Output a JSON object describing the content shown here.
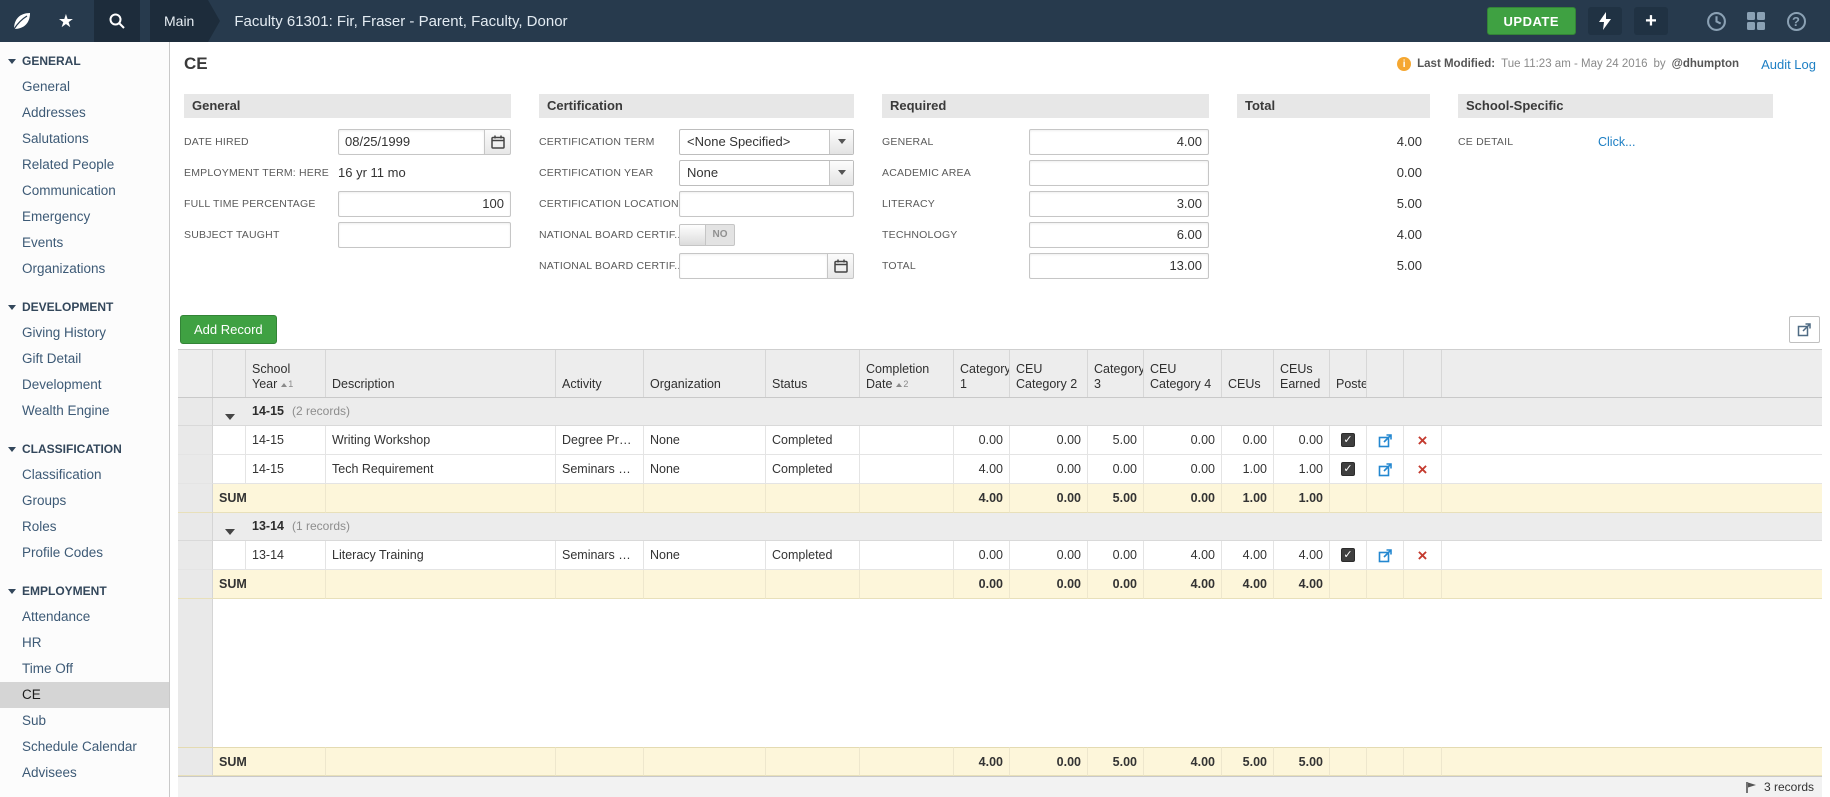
{
  "topbar": {
    "breadcrumb": "Main",
    "title": "Faculty 61301: Fir, Fraser - Parent, Faculty, Donor",
    "update": "UPDATE"
  },
  "sidebar": {
    "sections": [
      {
        "label": "GENERAL",
        "items": [
          "General",
          "Addresses",
          "Salutations",
          "Related People",
          "Communication",
          "Emergency",
          "Events",
          "Organizations"
        ]
      },
      {
        "label": "DEVELOPMENT",
        "items": [
          "Giving History",
          "Gift Detail",
          "Development",
          "Wealth Engine"
        ]
      },
      {
        "label": "CLASSIFICATION",
        "items": [
          "Classification",
          "Groups",
          "Roles",
          "Profile Codes"
        ]
      },
      {
        "label": "EMPLOYMENT",
        "items": [
          "Attendance",
          "HR",
          "Time Off",
          "CE",
          "Sub",
          "Schedule Calendar",
          "Advisees"
        ]
      }
    ]
  },
  "page": {
    "title": "CE",
    "last_modified_label": "Last Modified:",
    "last_modified_value": "Tue 11:23 am - May 24 2016",
    "by_label": "by",
    "by_user": "@dhumpton",
    "audit_log": "Audit Log"
  },
  "panels": {
    "general": {
      "title": "General",
      "date_hired_label": "DATE HIRED",
      "date_hired_value": "08/25/1999",
      "employment_term_label": "EMPLOYMENT TERM: HERE",
      "employment_term_value": "16 yr 11 mo",
      "full_time_label": "FULL TIME PERCENTAGE",
      "full_time_value": "100",
      "subject_taught_label": "SUBJECT TAUGHT",
      "subject_taught_value": ""
    },
    "certification": {
      "title": "Certification",
      "term_label": "CERTIFICATION TERM",
      "term_value": "<None Specified>",
      "year_label": "CERTIFICATION YEAR",
      "year_value": "None",
      "location_label": "CERTIFICATION LOCATION",
      "location_value": "",
      "board_toggle_label": "NATIONAL BOARD CERTIF...",
      "board_toggle_value": "NO",
      "board_date_label": "NATIONAL BOARD CERTIF...",
      "board_date_value": ""
    },
    "required": {
      "title": "Required",
      "rows": [
        {
          "label": "GENERAL",
          "value": "4.00"
        },
        {
          "label": "ACADEMIC AREA",
          "value": ""
        },
        {
          "label": "LITERACY",
          "value": "3.00"
        },
        {
          "label": "TECHNOLOGY",
          "value": "6.00"
        },
        {
          "label": "TOTAL",
          "value": "13.00"
        }
      ]
    },
    "total": {
      "title": "Total",
      "values": [
        "4.00",
        "0.00",
        "5.00",
        "4.00",
        "5.00"
      ]
    },
    "school_specific": {
      "title": "School-Specific",
      "ce_detail_label": "CE DETAIL",
      "ce_detail_link": "Click..."
    }
  },
  "grid": {
    "add_record": "Add Record",
    "columns": [
      {
        "line1": "School",
        "line2": "Year",
        "sort": "1"
      },
      {
        "line2": "Description"
      },
      {
        "line2": "Activity"
      },
      {
        "line2": "Organization"
      },
      {
        "line2": "Status"
      },
      {
        "line1": "Completion",
        "line2": "Date",
        "sort": "2"
      },
      {
        "line1": "Category",
        "line2": "1"
      },
      {
        "line1": "CEU",
        "line2": "Category 2"
      },
      {
        "line1": "Category",
        "line2": "3"
      },
      {
        "line1": "CEU",
        "line2": "Category 4"
      },
      {
        "line2": "CEUs"
      },
      {
        "line1": "CEUs",
        "line2": "Earned"
      },
      {
        "line2": "Poste…"
      }
    ],
    "groups": [
      {
        "label": "14-15",
        "count": "(2 records)",
        "rows": [
          {
            "year": "14-15",
            "description": "Writing Workshop",
            "activity": "Degree Pro…",
            "organization": "None",
            "status": "Completed",
            "date": "",
            "cat1": "0.00",
            "cat2": "0.00",
            "cat3": "5.00",
            "cat4": "0.00",
            "ceus": "0.00",
            "earned": "0.00"
          },
          {
            "year": "14-15",
            "description": "Tech Requirement",
            "activity": "Seminars &…",
            "organization": "None",
            "status": "Completed",
            "date": "",
            "cat1": "4.00",
            "cat2": "0.00",
            "cat3": "0.00",
            "cat4": "0.00",
            "ceus": "1.00",
            "earned": "1.00"
          }
        ],
        "sum": {
          "label": "SUM",
          "cat1": "4.00",
          "cat2": "0.00",
          "cat3": "5.00",
          "cat4": "0.00",
          "ceus": "1.00",
          "earned": "1.00"
        }
      },
      {
        "label": "13-14",
        "count": "(1 records)",
        "rows": [
          {
            "year": "13-14",
            "description": "Literacy Training",
            "activity": "Seminars &…",
            "organization": "None",
            "status": "Completed",
            "date": "",
            "cat1": "0.00",
            "cat2": "0.00",
            "cat3": "0.00",
            "cat4": "4.00",
            "ceus": "4.00",
            "earned": "4.00"
          }
        ],
        "sum": {
          "label": "SUM",
          "cat1": "0.00",
          "cat2": "0.00",
          "cat3": "0.00",
          "cat4": "4.00",
          "ceus": "4.00",
          "earned": "4.00"
        }
      }
    ],
    "grand_sum": {
      "label": "SUM",
      "cat1": "4.00",
      "cat2": "0.00",
      "cat3": "5.00",
      "cat4": "4.00",
      "ceus": "5.00",
      "earned": "5.00"
    },
    "records_count": "3 records"
  }
}
